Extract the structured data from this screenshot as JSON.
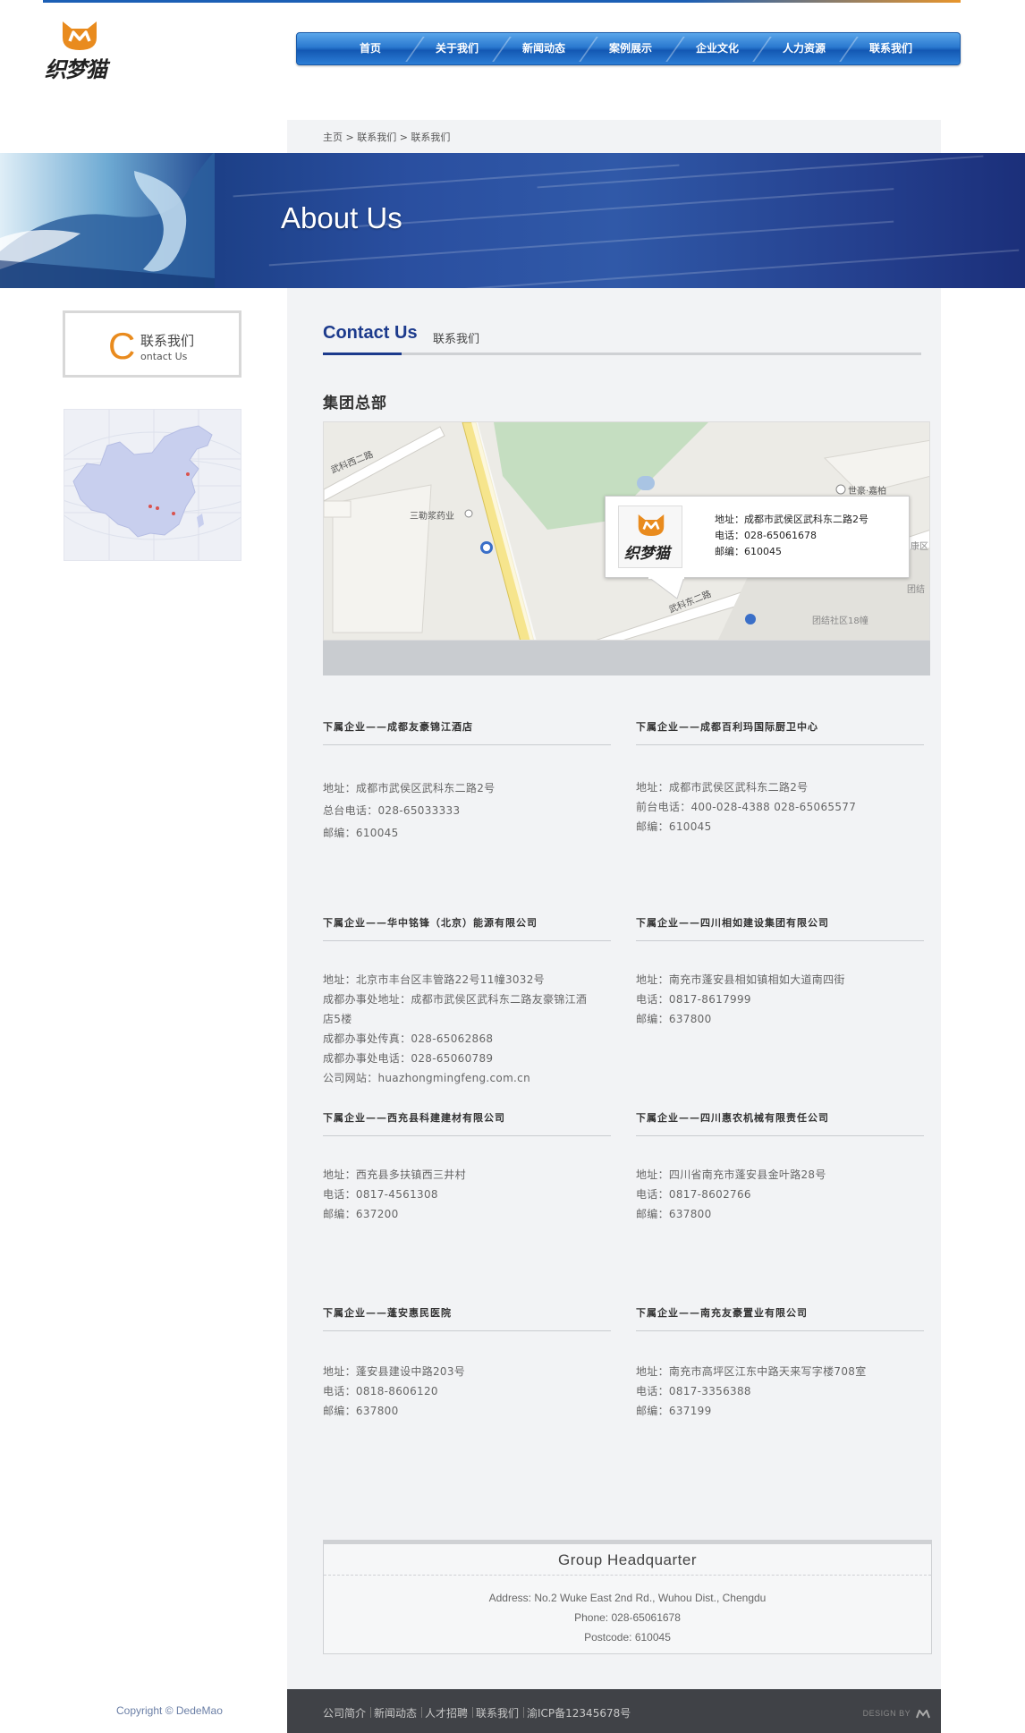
{
  "brand": {
    "logo_text": "织梦猫",
    "accent": "#e98b1e",
    "primary": "#1c3a8c"
  },
  "nav": {
    "items": [
      "首页",
      "关于我们",
      "新闻动态",
      "案例展示",
      "企业文化",
      "人力资源",
      "联系我们"
    ]
  },
  "breadcrumb": "主页 > 联系我们 > 联系我们",
  "banner": {
    "title": "About Us"
  },
  "sidebar": {
    "contact_c": "C",
    "contact_cn": "联系我们",
    "contact_en": "ontact Us"
  },
  "section": {
    "title_en": "Contact Us",
    "title_cn": "联系我们",
    "hq_title": "集团总部"
  },
  "map": {
    "labels": [
      "武科西二路",
      "三勒浆药业",
      "世豪·嘉柏",
      "武科东二路",
      "团结社区18幢",
      "康区",
      "团结"
    ],
    "popup": {
      "logo_text": "织梦猫",
      "address": "地址：成都市武侯区武科东二路2号",
      "phone": "电话：028-65061678",
      "postcode": "邮编：610045"
    }
  },
  "companies": [
    {
      "title": "下属企业——成都友豪锦江酒店",
      "lines": [
        "地址：成都市武侯区武科东二路2号",
        "总台电话：028-65033333",
        "邮编：610045"
      ]
    },
    {
      "title": "下属企业——成都百利玛国际厨卫中心",
      "lines": [
        "地址：成都市武侯区武科东二路2号",
        "前台电话：400-028-4388 028-65065577",
        "邮编：610045"
      ]
    },
    {
      "title": "下属企业——华中铭锋（北京）能源有限公司",
      "lines": [
        "地址：北京市丰台区丰管路22号11幢3032号",
        "成都办事处地址：成都市武侯区武科东二路友豪锦江酒",
        "店5楼",
        "成都办事处传真：028-65062868",
        "成都办事处电话：028-65060789",
        "公司网站：huazhongmingfeng.com.cn"
      ]
    },
    {
      "title": "下属企业——四川相如建设集团有限公司",
      "lines": [
        "地址：南充市蓬安县相如镇相如大道南四街",
        "电话：0817-8617999",
        "邮编：637800"
      ]
    },
    {
      "title": "下属企业——西充县科建建材有限公司",
      "lines": [
        "地址：西充县多扶镇西三井村",
        "电话：0817-4561308",
        "邮编：637200"
      ]
    },
    {
      "title": "下属企业——四川惠农机械有限责任公司",
      "lines": [
        "地址：四川省南充市蓬安县金叶路28号",
        "电话：0817-8602766",
        "邮编：637800"
      ]
    },
    {
      "title": "下属企业——蓬安惠民医院",
      "lines": [
        "地址：蓬安县建设中路203号",
        "电话：0818-8606120",
        "邮编：637800"
      ]
    },
    {
      "title": "下属企业——南充友豪置业有限公司",
      "lines": [
        "地址：南充市高坪区江东中路天来写字楼708室",
        "电话：0817-3356388",
        "邮编：637199"
      ]
    }
  ],
  "hq_box": {
    "title": "Group Headquarter",
    "address": "Address: No.2 Wuke East 2nd Rd., Wuhou Dist., Chengdu",
    "phone": "Phone: 028-65061678",
    "postcode": "Postcode: 610045"
  },
  "footer": {
    "copyright": "Copyright © DedeMao",
    "links": [
      "公司简介",
      "新闻动态",
      "人才招聘",
      "联系我们",
      "渝ICP备12345678号"
    ],
    "design_by": "DESIGN BY"
  }
}
